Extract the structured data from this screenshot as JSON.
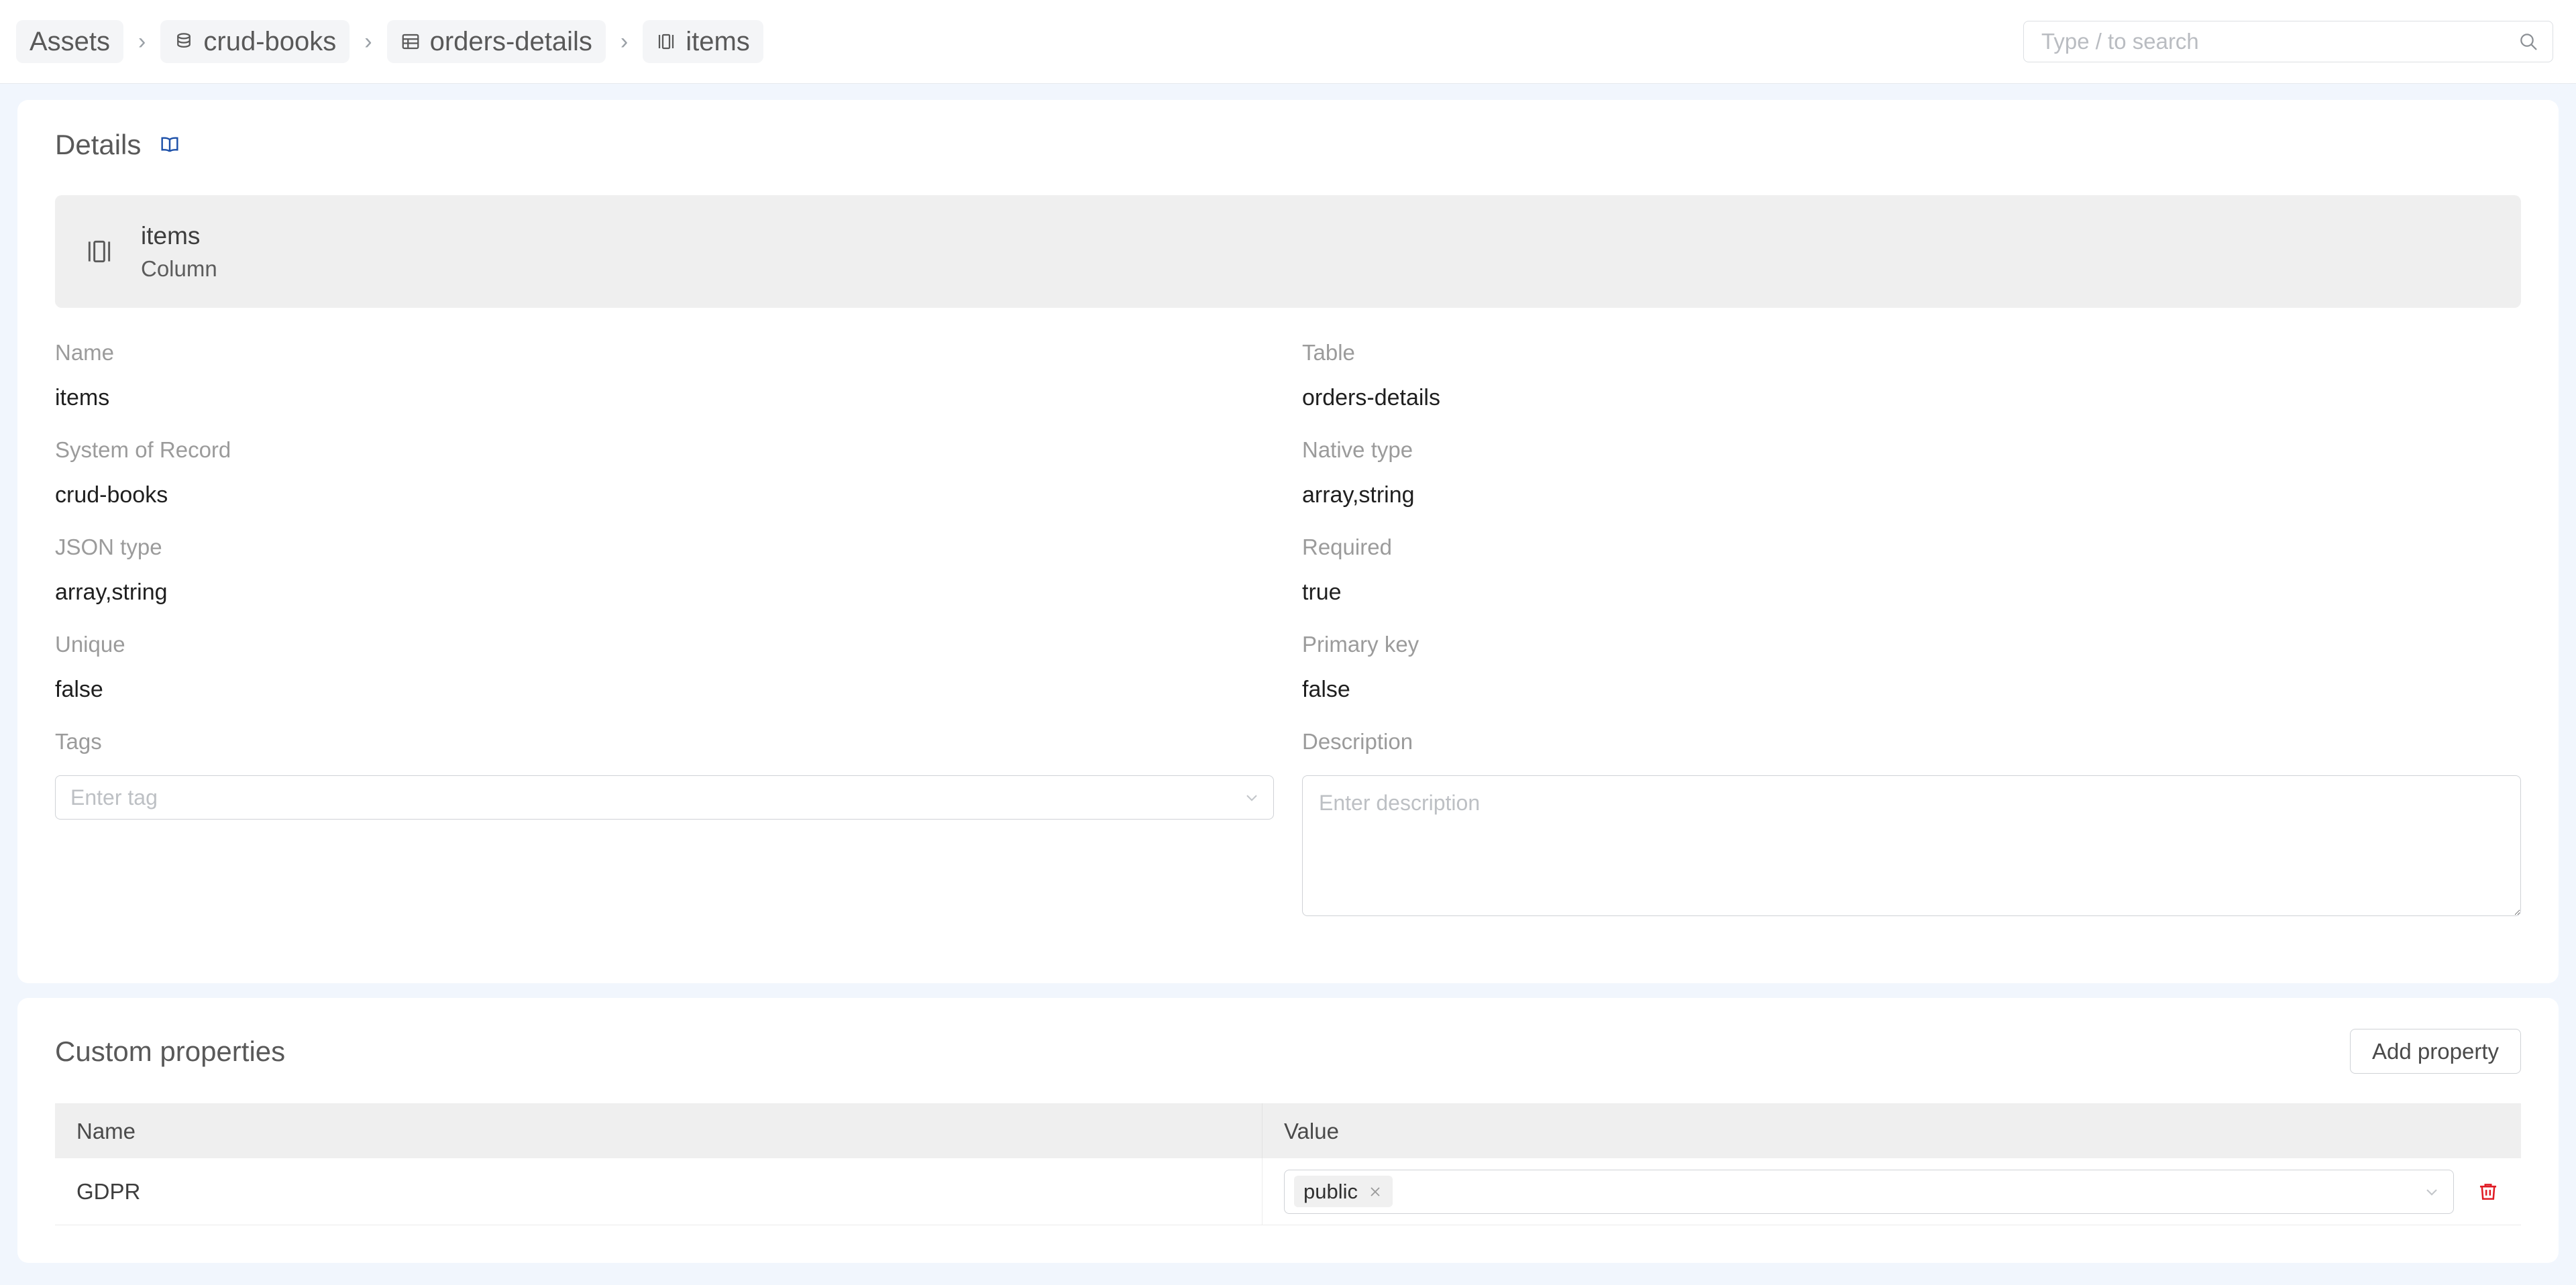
{
  "header": {
    "breadcrumb": [
      {
        "label": "Assets",
        "icon": null
      },
      {
        "label": "crud-books",
        "icon": "database-icon"
      },
      {
        "label": "orders-details",
        "icon": "table-icon"
      },
      {
        "label": "items",
        "icon": "column-icon"
      }
    ],
    "separator": "›",
    "search": {
      "placeholder": "Type / to search",
      "value": "",
      "icon": "search-icon"
    }
  },
  "details": {
    "title": "Details",
    "title_icon": "book-icon",
    "title_icon_color": "#1b4fa8",
    "asset": {
      "name": "items",
      "kind": "Column",
      "icon": "column-icon"
    },
    "fields": [
      {
        "label": "Name",
        "value": "items"
      },
      {
        "label": "Table",
        "value": "orders-details"
      },
      {
        "label": "System of Record",
        "value": "crud-books"
      },
      {
        "label": "Native type",
        "value": "array,string"
      },
      {
        "label": "JSON type",
        "value": "array,string"
      },
      {
        "label": "Required",
        "value": "true"
      },
      {
        "label": "Unique",
        "value": "false"
      },
      {
        "label": "Primary key",
        "value": "false"
      }
    ],
    "tags": {
      "label": "Tags",
      "placeholder": "Enter tag",
      "value": "",
      "chevron_icon": "chevron-down-icon"
    },
    "description": {
      "label": "Description",
      "placeholder": "Enter description",
      "value": ""
    }
  },
  "custom_properties": {
    "title": "Custom properties",
    "add_button": "Add property",
    "columns": [
      "Name",
      "Value"
    ],
    "rows": [
      {
        "name": "GDPR",
        "values": [
          "public"
        ],
        "chip_remove_icon": "close-icon",
        "chevron_icon": "chevron-down-icon",
        "delete_icon": "trash-icon",
        "delete_icon_color": "#e01b24"
      }
    ]
  }
}
